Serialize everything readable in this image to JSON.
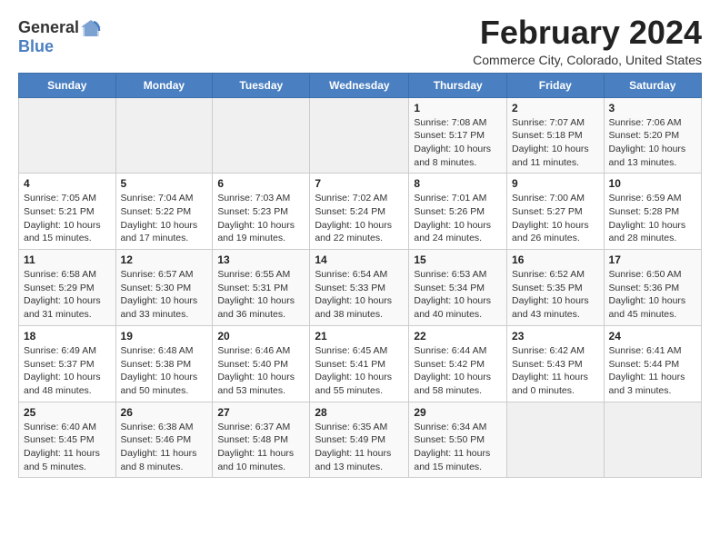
{
  "header": {
    "logo_general": "General",
    "logo_blue": "Blue",
    "month_title": "February 2024",
    "subtitle": "Commerce City, Colorado, United States"
  },
  "weekdays": [
    "Sunday",
    "Monday",
    "Tuesday",
    "Wednesday",
    "Thursday",
    "Friday",
    "Saturday"
  ],
  "weeks": [
    [
      {
        "day": "",
        "info": ""
      },
      {
        "day": "",
        "info": ""
      },
      {
        "day": "",
        "info": ""
      },
      {
        "day": "",
        "info": ""
      },
      {
        "day": "1",
        "info": "Sunrise: 7:08 AM\nSunset: 5:17 PM\nDaylight: 10 hours\nand 8 minutes."
      },
      {
        "day": "2",
        "info": "Sunrise: 7:07 AM\nSunset: 5:18 PM\nDaylight: 10 hours\nand 11 minutes."
      },
      {
        "day": "3",
        "info": "Sunrise: 7:06 AM\nSunset: 5:20 PM\nDaylight: 10 hours\nand 13 minutes."
      }
    ],
    [
      {
        "day": "4",
        "info": "Sunrise: 7:05 AM\nSunset: 5:21 PM\nDaylight: 10 hours\nand 15 minutes."
      },
      {
        "day": "5",
        "info": "Sunrise: 7:04 AM\nSunset: 5:22 PM\nDaylight: 10 hours\nand 17 minutes."
      },
      {
        "day": "6",
        "info": "Sunrise: 7:03 AM\nSunset: 5:23 PM\nDaylight: 10 hours\nand 19 minutes."
      },
      {
        "day": "7",
        "info": "Sunrise: 7:02 AM\nSunset: 5:24 PM\nDaylight: 10 hours\nand 22 minutes."
      },
      {
        "day": "8",
        "info": "Sunrise: 7:01 AM\nSunset: 5:26 PM\nDaylight: 10 hours\nand 24 minutes."
      },
      {
        "day": "9",
        "info": "Sunrise: 7:00 AM\nSunset: 5:27 PM\nDaylight: 10 hours\nand 26 minutes."
      },
      {
        "day": "10",
        "info": "Sunrise: 6:59 AM\nSunset: 5:28 PM\nDaylight: 10 hours\nand 28 minutes."
      }
    ],
    [
      {
        "day": "11",
        "info": "Sunrise: 6:58 AM\nSunset: 5:29 PM\nDaylight: 10 hours\nand 31 minutes."
      },
      {
        "day": "12",
        "info": "Sunrise: 6:57 AM\nSunset: 5:30 PM\nDaylight: 10 hours\nand 33 minutes."
      },
      {
        "day": "13",
        "info": "Sunrise: 6:55 AM\nSunset: 5:31 PM\nDaylight: 10 hours\nand 36 minutes."
      },
      {
        "day": "14",
        "info": "Sunrise: 6:54 AM\nSunset: 5:33 PM\nDaylight: 10 hours\nand 38 minutes."
      },
      {
        "day": "15",
        "info": "Sunrise: 6:53 AM\nSunset: 5:34 PM\nDaylight: 10 hours\nand 40 minutes."
      },
      {
        "day": "16",
        "info": "Sunrise: 6:52 AM\nSunset: 5:35 PM\nDaylight: 10 hours\nand 43 minutes."
      },
      {
        "day": "17",
        "info": "Sunrise: 6:50 AM\nSunset: 5:36 PM\nDaylight: 10 hours\nand 45 minutes."
      }
    ],
    [
      {
        "day": "18",
        "info": "Sunrise: 6:49 AM\nSunset: 5:37 PM\nDaylight: 10 hours\nand 48 minutes."
      },
      {
        "day": "19",
        "info": "Sunrise: 6:48 AM\nSunset: 5:38 PM\nDaylight: 10 hours\nand 50 minutes."
      },
      {
        "day": "20",
        "info": "Sunrise: 6:46 AM\nSunset: 5:40 PM\nDaylight: 10 hours\nand 53 minutes."
      },
      {
        "day": "21",
        "info": "Sunrise: 6:45 AM\nSunset: 5:41 PM\nDaylight: 10 hours\nand 55 minutes."
      },
      {
        "day": "22",
        "info": "Sunrise: 6:44 AM\nSunset: 5:42 PM\nDaylight: 10 hours\nand 58 minutes."
      },
      {
        "day": "23",
        "info": "Sunrise: 6:42 AM\nSunset: 5:43 PM\nDaylight: 11 hours\nand 0 minutes."
      },
      {
        "day": "24",
        "info": "Sunrise: 6:41 AM\nSunset: 5:44 PM\nDaylight: 11 hours\nand 3 minutes."
      }
    ],
    [
      {
        "day": "25",
        "info": "Sunrise: 6:40 AM\nSunset: 5:45 PM\nDaylight: 11 hours\nand 5 minutes."
      },
      {
        "day": "26",
        "info": "Sunrise: 6:38 AM\nSunset: 5:46 PM\nDaylight: 11 hours\nand 8 minutes."
      },
      {
        "day": "27",
        "info": "Sunrise: 6:37 AM\nSunset: 5:48 PM\nDaylight: 11 hours\nand 10 minutes."
      },
      {
        "day": "28",
        "info": "Sunrise: 6:35 AM\nSunset: 5:49 PM\nDaylight: 11 hours\nand 13 minutes."
      },
      {
        "day": "29",
        "info": "Sunrise: 6:34 AM\nSunset: 5:50 PM\nDaylight: 11 hours\nand 15 minutes."
      },
      {
        "day": "",
        "info": ""
      },
      {
        "day": "",
        "info": ""
      }
    ]
  ]
}
